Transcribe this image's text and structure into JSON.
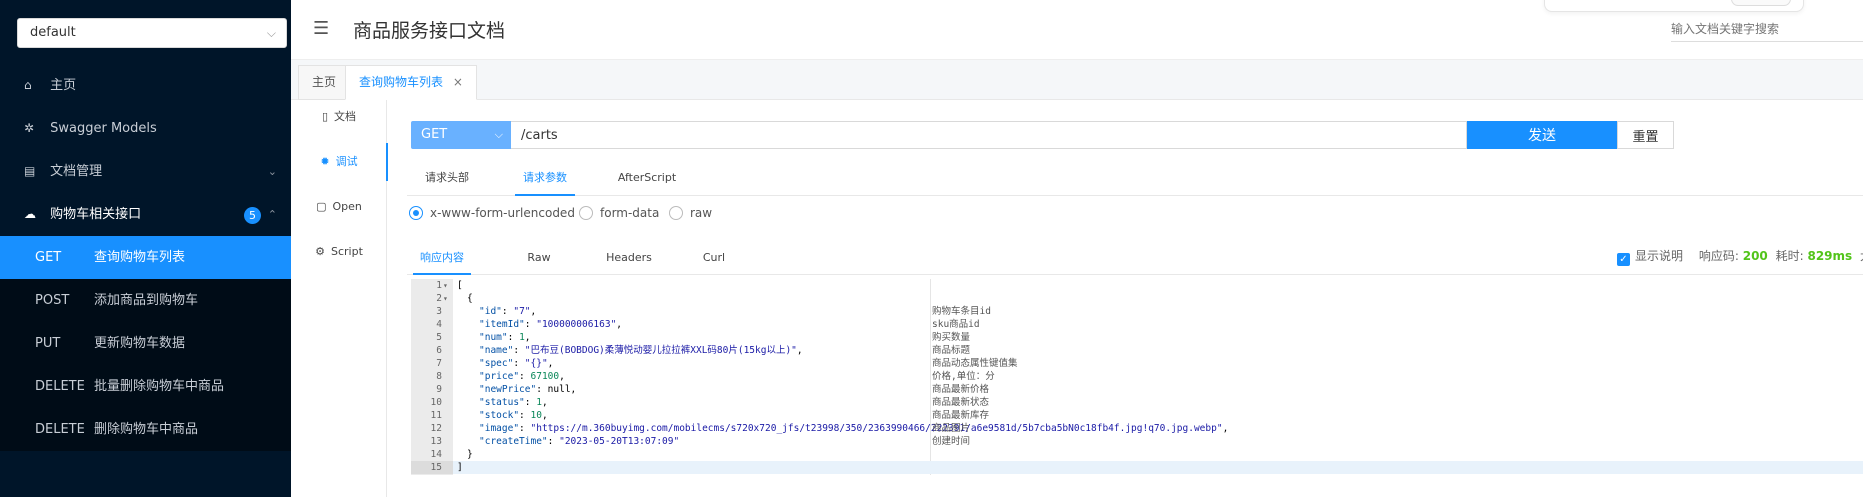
{
  "sidebar": {
    "group_select": "default",
    "menu": [
      {
        "icon": "home-icon",
        "glyph": "⌂",
        "label": "主页"
      },
      {
        "icon": "swagger-models-icon",
        "glyph": "✲",
        "label": "Swagger Models"
      },
      {
        "icon": "document-manage-icon",
        "glyph": "▤",
        "label": "文档管理"
      },
      {
        "icon": "cloud-icon",
        "glyph": "☁",
        "label": "购物车相关接口",
        "badge": "5"
      }
    ],
    "apis": [
      {
        "method": "GET",
        "label": "查询购物车列表"
      },
      {
        "method": "POST",
        "label": "添加商品到购物车"
      },
      {
        "method": "PUT",
        "label": "更新购物车数据"
      },
      {
        "method": "DELETE",
        "label": "批量删除购物车中商品"
      },
      {
        "method": "DELETE",
        "label": "删除购物车中商品"
      }
    ]
  },
  "header": {
    "title": "商品服务接口文档",
    "search_placeholder": "输入文档关键字搜索"
  },
  "page_tabs": [
    {
      "label": "主页"
    },
    {
      "label": "查询购物车列表",
      "close": "×"
    }
  ],
  "vtabs": [
    {
      "icon": "doc-icon",
      "glyph": "▯",
      "label": "文档"
    },
    {
      "icon": "bug-icon",
      "glyph": "✹",
      "label": "调试"
    },
    {
      "icon": "open-icon",
      "glyph": "▢",
      "label": "Open"
    },
    {
      "icon": "script-icon",
      "glyph": "⚙",
      "label": "Script"
    }
  ],
  "request": {
    "method": "GET",
    "url": "/carts",
    "send": "发送",
    "reset": "重置"
  },
  "param_tabs": [
    "请求头部",
    "请求参数",
    "AfterScript"
  ],
  "radios": [
    "x-www-form-urlencoded",
    "form-data",
    "raw"
  ],
  "resp_tabs": [
    "响应内容",
    "Raw",
    "Headers",
    "Curl"
  ],
  "resp_meta": {
    "show_desc": "显示说明",
    "code_label": "响应码:",
    "code": "200",
    "time_label": "耗时:",
    "time": "829ms",
    "size_label": "大小"
  },
  "code": {
    "line_numbers": [
      "1",
      "2",
      "3",
      "4",
      "5",
      "6",
      "7",
      "8",
      "9",
      "10",
      "11",
      "12",
      "13",
      "14",
      "15"
    ],
    "open_bracket": "[",
    "open_brace": "{",
    "close_brace": "}",
    "close_bracket": "]",
    "fields": [
      {
        "key": "\"id\"",
        "value": "\"7\"",
        "comment": "购物车条目id"
      },
      {
        "key": "\"itemId\"",
        "value": "\"100000006163\"",
        "comment": "sku商品id"
      },
      {
        "key": "\"num\"",
        "value": "1",
        "comment": "购买数量"
      },
      {
        "key": "\"name\"",
        "value": "\"巴布豆(BOBDOG)柔薄悦动婴儿拉拉裤XXL码80片(15kg以上)\"",
        "comment": "商品标题"
      },
      {
        "key": "\"spec\"",
        "value": "\"{}\"",
        "comment": "商品动态属性键值集"
      },
      {
        "key": "\"price\"",
        "value": "67100",
        "comment": "价格,单位：分"
      },
      {
        "key": "\"newPrice\"",
        "value": "null",
        "comment": "商品最新价格"
      },
      {
        "key": "\"status\"",
        "value": "1",
        "comment": "商品最新状态"
      },
      {
        "key": "\"stock\"",
        "value": "10",
        "comment": "商品最新库存"
      },
      {
        "key": "\"image\"",
        "value": "\"https://m.360buyimg.com/mobilecms/s720x720_jfs/t23998/350/2363990466/222391/a6e9581d/5b7cba5bN0c18fb4f.jpg!q70.jpg.webp\"",
        "comment": "商品图片"
      },
      {
        "key": "\"createTime\"",
        "value": "\"2023-05-20T13:07:09\"",
        "comment": "创建时间"
      }
    ]
  }
}
